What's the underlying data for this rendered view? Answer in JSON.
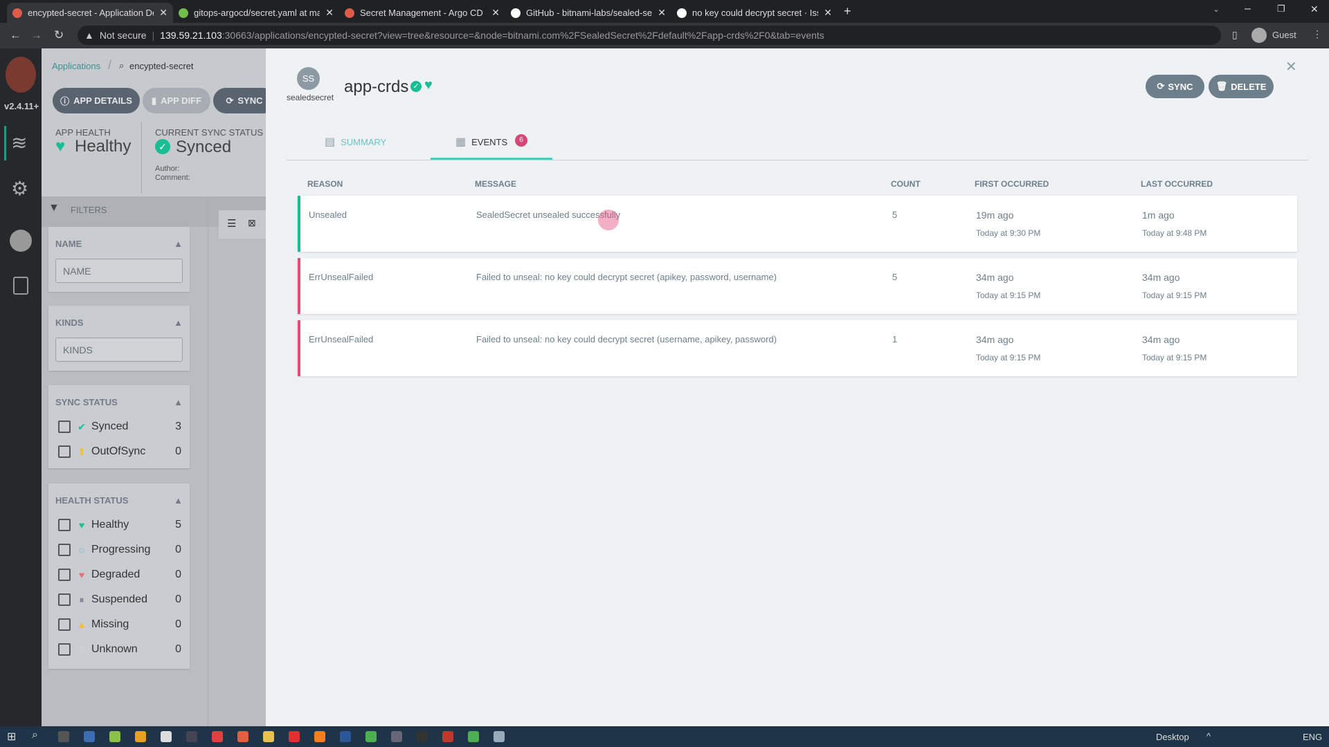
{
  "browser": {
    "tabs": [
      {
        "title": "encypted-secret - Application De",
        "active": true,
        "color": "#e05a47"
      },
      {
        "title": "gitops-argocd/secret.yaml at ma",
        "color": "#6fbf4a"
      },
      {
        "title": "Secret Management - Argo CD -",
        "color": "#e05a47"
      },
      {
        "title": "GitHub - bitnami-labs/sealed-sec",
        "color": "#ffffff"
      },
      {
        "title": "no key could decrypt secret · Issu",
        "color": "#ffffff"
      }
    ],
    "not_secure": "Not secure",
    "url_host": "139.59.21.103",
    "url_rest": ":30663/applications/encypted-secret?view=tree&resource=&node=bitnami.com%2FSealedSecret%2Fdefault%2Fapp-crds%2F0&tab=events",
    "profile": "Guest"
  },
  "nav": {
    "version": "v2.4.11+"
  },
  "breadcrumb": {
    "root": "Applications",
    "current": "encypted-secret"
  },
  "toolbar": {
    "app_details": "APP DETAILS",
    "app_diff": "APP DIFF",
    "sync": "SYNC"
  },
  "status": {
    "health_label": "APP HEALTH",
    "health": "Healthy",
    "sync_label": "CURRENT SYNC STATUS",
    "sync": "Synced",
    "author": "Author:",
    "comment": "Comment:"
  },
  "filters": {
    "title": "FILTERS",
    "name_label": "NAME",
    "name_placeholder": "NAME",
    "kinds_label": "KINDS",
    "kinds_placeholder": "KINDS",
    "sync_label": "SYNC STATUS",
    "sync_items": [
      {
        "label": "Synced",
        "count": "3",
        "icon": "check-circle",
        "color": "#18be94"
      },
      {
        "label": "OutOfSync",
        "count": "0",
        "icon": "arrow-up-circle",
        "color": "#f4c030"
      }
    ],
    "health_label": "HEALTH STATUS",
    "health_items": [
      {
        "label": "Healthy",
        "count": "5",
        "icon": "heart",
        "color": "#18be94"
      },
      {
        "label": "Progressing",
        "count": "0",
        "icon": "spinner",
        "color": "#0dadea"
      },
      {
        "label": "Degraded",
        "count": "0",
        "icon": "heart-broken",
        "color": "#e96d76"
      },
      {
        "label": "Suspended",
        "count": "0",
        "icon": "pause-circle",
        "color": "#766f94"
      },
      {
        "label": "Missing",
        "count": "0",
        "icon": "ghost",
        "color": "#f4c030"
      },
      {
        "label": "Unknown",
        "count": "0",
        "icon": "question-circle",
        "color": "#ccd6dd"
      }
    ]
  },
  "panel": {
    "kind_abbr": "SS",
    "kind": "sealedsecret",
    "title": "app-crds",
    "sync_btn": "SYNC",
    "delete_btn": "DELETE",
    "tabs": [
      {
        "label": "SUMMARY"
      },
      {
        "label": "EVENTS",
        "badge": "6",
        "active": true
      }
    ],
    "columns": [
      "REASON",
      "MESSAGE",
      "COUNT",
      "FIRST OCCURRED",
      "LAST OCCURRED"
    ],
    "events": [
      {
        "reason": "Unsealed",
        "message": "SealedSecret unsealed successfully",
        "count": "5",
        "first": "19m ago",
        "first_abs": "Today at 9:30 PM",
        "last": "1m ago",
        "last_abs": "Today at 9:48 PM",
        "type": "normal",
        "color": "#18be94"
      },
      {
        "reason": "ErrUnsealFailed",
        "message": "Failed to unseal: no key could decrypt secret (apikey, password, username)",
        "count": "5",
        "first": "34m ago",
        "first_abs": "Today at 9:15 PM",
        "last": "34m ago",
        "last_abs": "Today at 9:15 PM",
        "type": "warning",
        "color": "#e54d79"
      },
      {
        "reason": "ErrUnsealFailed",
        "message": "Failed to unseal: no key could decrypt secret (username, apikey, password)",
        "count": "1",
        "first": "34m ago",
        "first_abs": "Today at 9:15 PM",
        "last": "34m ago",
        "last_abs": "Today at 9:15 PM",
        "type": "warning",
        "color": "#e54d79"
      }
    ]
  },
  "taskbar": {
    "desktop": "Desktop",
    "lang": "ENG"
  }
}
